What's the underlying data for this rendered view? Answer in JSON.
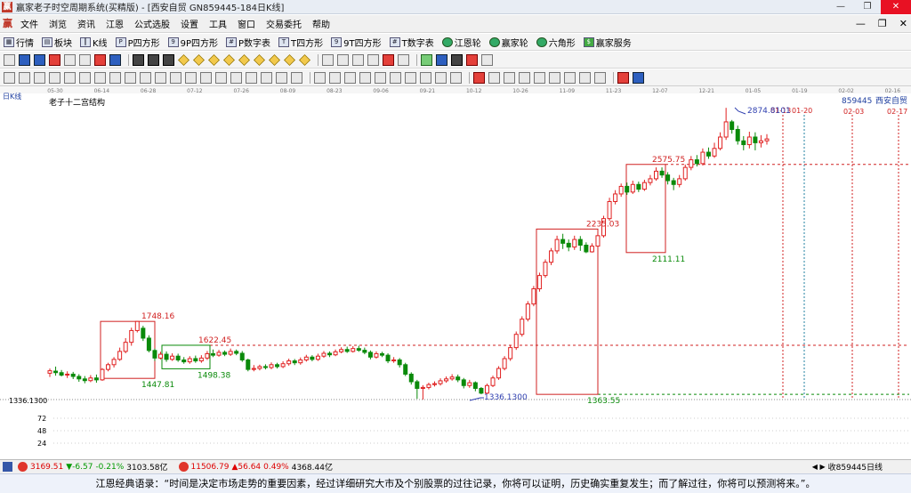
{
  "window": {
    "title": "赢家老子时空周期系统(买精版) - [西安自贸  GN859445-184日K线]",
    "buttons": {
      "minimize": "—",
      "restore": "❐",
      "close": "✕"
    }
  },
  "menubar": {
    "items": [
      "文件",
      "浏览",
      "资讯",
      "江恩",
      "公式选股",
      "设置",
      "工具",
      "窗口",
      "交易委托",
      "帮助"
    ]
  },
  "toolbar1": {
    "items": [
      {
        "label": "行情",
        "icon": "table-icon"
      },
      {
        "label": "板块",
        "icon": "blocks-icon"
      },
      {
        "label": "K线",
        "icon": "kline-icon"
      },
      {
        "label": "P四方形",
        "icon": "square-p-icon"
      },
      {
        "label": "9P四方形",
        "icon": "square-9p-icon"
      },
      {
        "label": "P数字表",
        "icon": "numbers-p-icon"
      },
      {
        "label": "T四方形",
        "icon": "square-t-icon"
      },
      {
        "label": "9T四方形",
        "icon": "square-9t-icon"
      },
      {
        "label": "T数字表",
        "icon": "numbers-t-icon"
      },
      {
        "label": "江恩轮",
        "icon": "gann-wheel-icon"
      },
      {
        "label": "赢家轮",
        "icon": "winner-wheel-icon"
      },
      {
        "label": "六角形",
        "icon": "hexagon-icon"
      },
      {
        "label": "赢家服务",
        "icon": "dollar-icon"
      }
    ]
  },
  "statusbar": {
    "index1": {
      "value": "3169.51",
      "change": "▼-6.57",
      "pct": "-0.21%",
      "amount": "3103.58亿"
    },
    "index2": {
      "value": "11506.79",
      "change": "▲56.64",
      "pct": "0.49%",
      "amount": "4368.44亿"
    },
    "stock_box": {
      "nav": "◀ ▶",
      "code": "收859445日线"
    }
  },
  "quote": {
    "text": "江恩经典语录：“时间是决定市场走势的重要因素，经过详细研究大市及个别股票的过往记录，你将可以证明，历史确实重复发生；而了解过往，你将可以预测将来。”。"
  },
  "colors": {
    "up": "#e02020",
    "down": "#0a8a0a",
    "box": "#d02020",
    "green_box": "#0a8a0a",
    "blue_label": "#3040b0",
    "grid": "#0000ff"
  },
  "chart_data": {
    "type": "candlestick",
    "period_label": "日K线",
    "indicator_title": "老子十二宫结构",
    "stock_label": {
      "code": "859445",
      "name": "西安自贸"
    },
    "x_dates": [
      "05-30",
      "06-14",
      "06-28",
      "07-12",
      "07-26",
      "08-09",
      "08-23",
      "09-06",
      "09-21",
      "10-12",
      "10-26",
      "11-09",
      "11-23",
      "12-07",
      "12-21",
      "01-05",
      "01-19",
      "02-02",
      "02-16"
    ],
    "future_dates": [
      "01-13",
      "01-20",
      "02-03",
      "02-17"
    ],
    "ylim": [
      0,
      3000
    ],
    "y_ticks": [
      24,
      48,
      72
    ],
    "baseline_label": "1336.1300",
    "price_annotations": [
      {
        "text": "1748.16",
        "color": "red"
      },
      {
        "text": "1447.81",
        "color": "green"
      },
      {
        "text": "1622.45",
        "color": "red"
      },
      {
        "text": "1498.38",
        "color": "green"
      },
      {
        "text": "1336.1300",
        "color": "blue"
      },
      {
        "text": "1363.55",
        "color": "green"
      },
      {
        "text": "2235.03",
        "color": "red"
      },
      {
        "text": "2111.11",
        "color": "green"
      },
      {
        "text": "2575.75",
        "color": "red"
      },
      {
        "text": "2874.8101",
        "color": "blue"
      }
    ],
    "boxes": [
      {
        "low": 1447.81,
        "high": 1748.16,
        "color": "red"
      },
      {
        "low": 1498.38,
        "high": 1622.45,
        "color": "green"
      },
      {
        "low": 1363.55,
        "high": 2235.03,
        "color": "red"
      },
      {
        "low": 2111.11,
        "high": 2575.75,
        "color": "red"
      }
    ],
    "horizontal_levels": [
      {
        "value": 1622.45,
        "color": "red",
        "style": "dashed"
      },
      {
        "value": 1363.55,
        "color": "green",
        "style": "dashed"
      },
      {
        "value": 2575.75,
        "color": "red",
        "style": "dashed"
      }
    ],
    "candles": [
      [
        1475,
        1488,
        1455,
        1500
      ],
      [
        1486,
        1478,
        1462,
        1510
      ],
      [
        1478,
        1465,
        1458,
        1492
      ],
      [
        1466,
        1470,
        1450,
        1485
      ],
      [
        1470,
        1458,
        1444,
        1482
      ],
      [
        1458,
        1445,
        1430,
        1470
      ],
      [
        1445,
        1436,
        1422,
        1460
      ],
      [
        1436,
        1450,
        1428,
        1465
      ],
      [
        1450,
        1440,
        1425,
        1468
      ],
      [
        1440,
        1495,
        1435,
        1502
      ],
      [
        1495,
        1520,
        1485,
        1530
      ],
      [
        1520,
        1548,
        1505,
        1560
      ],
      [
        1548,
        1590,
        1540,
        1610
      ],
      [
        1590,
        1638,
        1580,
        1660
      ],
      [
        1638,
        1700,
        1620,
        1715
      ],
      [
        1700,
        1748,
        1690,
        1750
      ],
      [
        1712,
        1660,
        1645,
        1725
      ],
      [
        1660,
        1595,
        1585,
        1675
      ],
      [
        1595,
        1555,
        1540,
        1605
      ],
      [
        1555,
        1575,
        1548,
        1588
      ],
      [
        1575,
        1548,
        1535,
        1590
      ],
      [
        1548,
        1565,
        1540,
        1580
      ],
      [
        1565,
        1545,
        1535,
        1578
      ],
      [
        1545,
        1535,
        1525,
        1560
      ],
      [
        1535,
        1552,
        1525,
        1565
      ],
      [
        1552,
        1540,
        1530,
        1568
      ],
      [
        1540,
        1555,
        1530,
        1570
      ],
      [
        1555,
        1578,
        1545,
        1592
      ],
      [
        1578,
        1570,
        1560,
        1600
      ],
      [
        1570,
        1585,
        1562,
        1598
      ],
      [
        1585,
        1575,
        1565,
        1595
      ],
      [
        1575,
        1590,
        1566,
        1605
      ],
      [
        1590,
        1580,
        1570,
        1600
      ],
      [
        1580,
        1545,
        1535,
        1592
      ],
      [
        1545,
        1495,
        1485,
        1552
      ],
      [
        1495,
        1500,
        1485,
        1518
      ],
      [
        1500,
        1510,
        1490,
        1520
      ],
      [
        1510,
        1505,
        1495,
        1522
      ],
      [
        1505,
        1520,
        1496,
        1532
      ],
      [
        1520,
        1510,
        1500,
        1530
      ],
      [
        1510,
        1525,
        1502,
        1538
      ],
      [
        1525,
        1540,
        1515,
        1552
      ],
      [
        1540,
        1530,
        1518,
        1550
      ],
      [
        1530,
        1545,
        1520,
        1558
      ],
      [
        1545,
        1560,
        1536,
        1572
      ],
      [
        1560,
        1548,
        1538,
        1570
      ],
      [
        1548,
        1565,
        1540,
        1578
      ],
      [
        1565,
        1580,
        1556,
        1592
      ],
      [
        1580,
        1572,
        1560,
        1590
      ],
      [
        1572,
        1588,
        1565,
        1600
      ],
      [
        1588,
        1600,
        1580,
        1612
      ],
      [
        1600,
        1590,
        1582,
        1615
      ],
      [
        1590,
        1605,
        1584,
        1618
      ],
      [
        1605,
        1596,
        1588,
        1620
      ],
      [
        1596,
        1585,
        1575,
        1610
      ],
      [
        1585,
        1560,
        1548,
        1595
      ],
      [
        1560,
        1578,
        1552,
        1590
      ],
      [
        1578,
        1570,
        1560,
        1588
      ],
      [
        1570,
        1540,
        1528,
        1580
      ],
      [
        1540,
        1545,
        1530,
        1560
      ],
      [
        1545,
        1520,
        1505,
        1555
      ],
      [
        1520,
        1470,
        1460,
        1530
      ],
      [
        1470,
        1430,
        1415,
        1480
      ],
      [
        1430,
        1395,
        1340,
        1440
      ],
      [
        1395,
        1400,
        1336,
        1412
      ],
      [
        1400,
        1415,
        1390,
        1425
      ],
      [
        1415,
        1420,
        1405,
        1432
      ],
      [
        1420,
        1435,
        1410,
        1448
      ],
      [
        1435,
        1445,
        1425,
        1458
      ],
      [
        1445,
        1455,
        1436,
        1470
      ],
      [
        1455,
        1440,
        1428,
        1468
      ],
      [
        1440,
        1410,
        1395,
        1450
      ],
      [
        1410,
        1425,
        1398,
        1440
      ],
      [
        1425,
        1395,
        1380,
        1432
      ],
      [
        1395,
        1370,
        1364,
        1402
      ],
      [
        1370,
        1410,
        1365,
        1420
      ],
      [
        1410,
        1450,
        1402,
        1462
      ],
      [
        1450,
        1500,
        1440,
        1512
      ],
      [
        1500,
        1552,
        1490,
        1565
      ],
      [
        1552,
        1610,
        1540,
        1622
      ],
      [
        1610,
        1680,
        1598,
        1695
      ],
      [
        1680,
        1760,
        1668,
        1775
      ],
      [
        1760,
        1840,
        1748,
        1855
      ],
      [
        1840,
        1920,
        1828,
        1935
      ],
      [
        1920,
        1990,
        1905,
        2005
      ],
      [
        1990,
        2060,
        1978,
        2075
      ],
      [
        2060,
        2120,
        2045,
        2135
      ],
      [
        2120,
        2180,
        2105,
        2200
      ],
      [
        2180,
        2160,
        2130,
        2210
      ],
      [
        2160,
        2140,
        2118,
        2180
      ],
      [
        2140,
        2180,
        2125,
        2200
      ],
      [
        2180,
        2150,
        2120,
        2198
      ],
      [
        2150,
        2115,
        2108,
        2165
      ],
      [
        2115,
        2145,
        2111,
        2160
      ],
      [
        2145,
        2200,
        2138,
        2215
      ],
      [
        2200,
        2290,
        2190,
        2305
      ],
      [
        2290,
        2380,
        2278,
        2400
      ],
      [
        2380,
        2420,
        2365,
        2440
      ],
      [
        2420,
        2460,
        2405,
        2475
      ],
      [
        2460,
        2430,
        2415,
        2480
      ],
      [
        2430,
        2470,
        2420,
        2490
      ],
      [
        2470,
        2445,
        2430,
        2485
      ],
      [
        2445,
        2480,
        2436,
        2495
      ],
      [
        2480,
        2500,
        2465,
        2520
      ],
      [
        2500,
        2540,
        2490,
        2560
      ],
      [
        2540,
        2520,
        2505,
        2560
      ],
      [
        2520,
        2490,
        2470,
        2535
      ],
      [
        2490,
        2470,
        2440,
        2505
      ],
      [
        2470,
        2500,
        2455,
        2520
      ],
      [
        2500,
        2560,
        2490,
        2575
      ],
      [
        2560,
        2600,
        2545,
        2620
      ],
      [
        2600,
        2580,
        2565,
        2625
      ],
      [
        2580,
        2640,
        2570,
        2660
      ],
      [
        2640,
        2620,
        2605,
        2665
      ],
      [
        2620,
        2660,
        2610,
        2690
      ],
      [
        2660,
        2720,
        2650,
        2745
      ],
      [
        2720,
        2800,
        2705,
        2874
      ],
      [
        2800,
        2760,
        2738,
        2810
      ],
      [
        2760,
        2700,
        2680,
        2780
      ],
      [
        2700,
        2680,
        2650,
        2725
      ],
      [
        2680,
        2720,
        2660,
        2748
      ],
      [
        2720,
        2690,
        2650,
        2745
      ],
      [
        2690,
        2700,
        2665,
        2730
      ],
      [
        2700,
        2710,
        2680,
        2735
      ]
    ]
  }
}
